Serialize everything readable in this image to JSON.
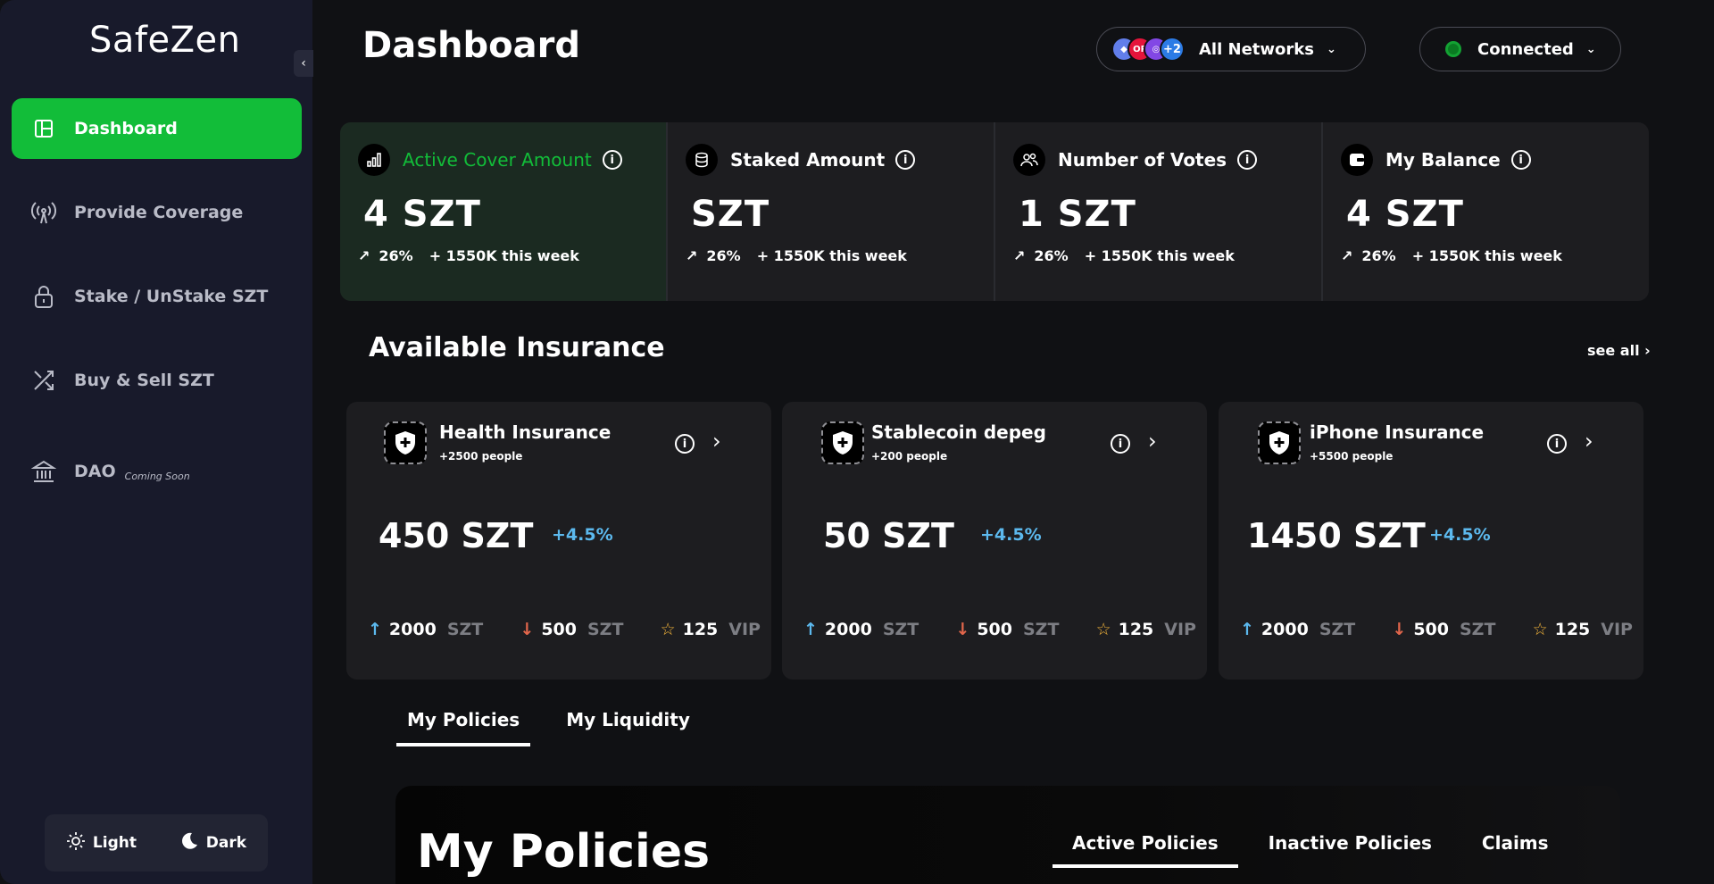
{
  "sidebar": {
    "brand": "SafeZen",
    "items": [
      {
        "label": "Dashboard",
        "icon": "dashboard-icon"
      },
      {
        "label": "Provide Coverage",
        "icon": "broadcast-icon"
      },
      {
        "label": "Stake / UnStake SZT",
        "icon": "lock-icon"
      },
      {
        "label": "Buy & Sell SZT",
        "icon": "shuffle-icon"
      },
      {
        "label": "DAO",
        "icon": "bank-icon",
        "badge": "Coming Soon"
      }
    ],
    "theme": {
      "light": "Light",
      "dark": "Dark"
    }
  },
  "header": {
    "title": "Dashboard",
    "network": {
      "label": "All Networks",
      "extra": "+2"
    },
    "wallet": {
      "label": "Connected"
    }
  },
  "stats": [
    {
      "label": "Active Cover Amount",
      "value": "4 SZT",
      "pct": "26%",
      "week": "+ 1550K this week"
    },
    {
      "label": "Staked Amount",
      "value": "SZT",
      "pct": "26%",
      "week": "+ 1550K this week"
    },
    {
      "label": "Number of Votes",
      "value": "1 SZT",
      "pct": "26%",
      "week": "+ 1550K this week"
    },
    {
      "label": "My Balance",
      "value": "4 SZT",
      "pct": "26%",
      "week": "+ 1550K this week"
    }
  ],
  "insurance": {
    "title": "Available Insurance",
    "see_all": "see all",
    "cards": [
      {
        "name": "Health Insurance",
        "people": "+2500 people",
        "amount": "450 SZT",
        "change": "+4.5%",
        "up": "2000",
        "up_unit": "SZT",
        "down": "500",
        "down_unit": "SZT",
        "star": "125",
        "star_unit": "VIP"
      },
      {
        "name": "Stablecoin depeg",
        "people": "+200 people",
        "amount": "50 SZT",
        "change": "+4.5%",
        "up": "2000",
        "up_unit": "SZT",
        "down": "500",
        "down_unit": "SZT",
        "star": "125",
        "star_unit": "VIP"
      },
      {
        "name": "iPhone Insurance",
        "people": "+5500 people",
        "amount": "1450 SZT",
        "change": "+4.5%",
        "up": "2000",
        "up_unit": "SZT",
        "down": "500",
        "down_unit": "SZT",
        "star": "125",
        "star_unit": "VIP"
      }
    ]
  },
  "tabs": [
    "My Policies",
    "My Liquidity"
  ],
  "policies": {
    "title": "My Policies",
    "tabs": [
      "Active Policies",
      "Inactive Policies",
      "Claims"
    ]
  },
  "colors": {
    "accent": "#12bd39",
    "sidebar": "#181a2b",
    "card": "#1d1d20",
    "change": "#5cb9ee"
  }
}
